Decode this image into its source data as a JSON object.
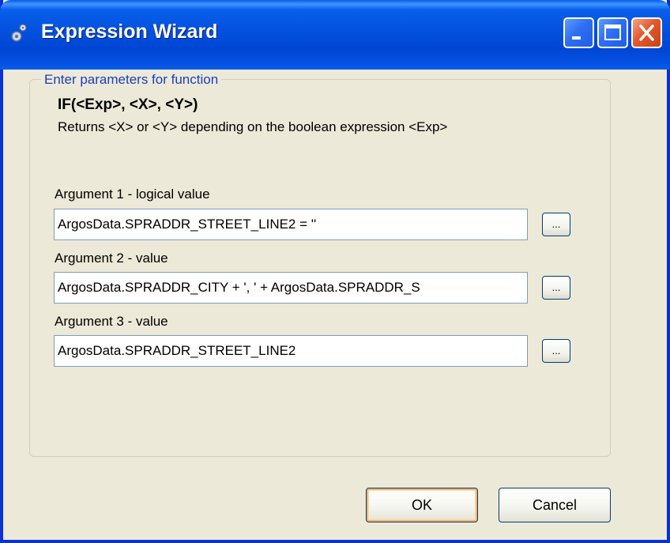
{
  "window": {
    "title": "Expression Wizard",
    "icon": "gear-icon",
    "controls": {
      "minimize_icon": "minimize-icon",
      "maximize_icon": "maximize-icon",
      "close_icon": "close-icon"
    }
  },
  "group": {
    "legend": "Enter parameters for function",
    "function_signature": "IF(<Exp>, <X>, <Y>)",
    "function_description": "Returns <X> or <Y> depending on the boolean expression <Exp>"
  },
  "arguments": [
    {
      "label": "Argument 1 - logical value",
      "value": "ArgosData.SPRADDR_STREET_LINE2 = ''",
      "browse_label": "..."
    },
    {
      "label": "Argument 2 - value",
      "value": "ArgosData.SPRADDR_CITY + ', ' + ArgosData.SPRADDR_S",
      "browse_label": "..."
    },
    {
      "label": "Argument 3 - value",
      "value": "ArgosData.SPRADDR_STREET_LINE2",
      "browse_label": "..."
    }
  ],
  "buttons": {
    "ok_label": "OK",
    "cancel_label": "Cancel"
  },
  "colors": {
    "titlebar": "#0453e0",
    "window_bg": "#ece9d8",
    "legend_text": "#1c3ebc",
    "close_button": "#e4582d"
  }
}
